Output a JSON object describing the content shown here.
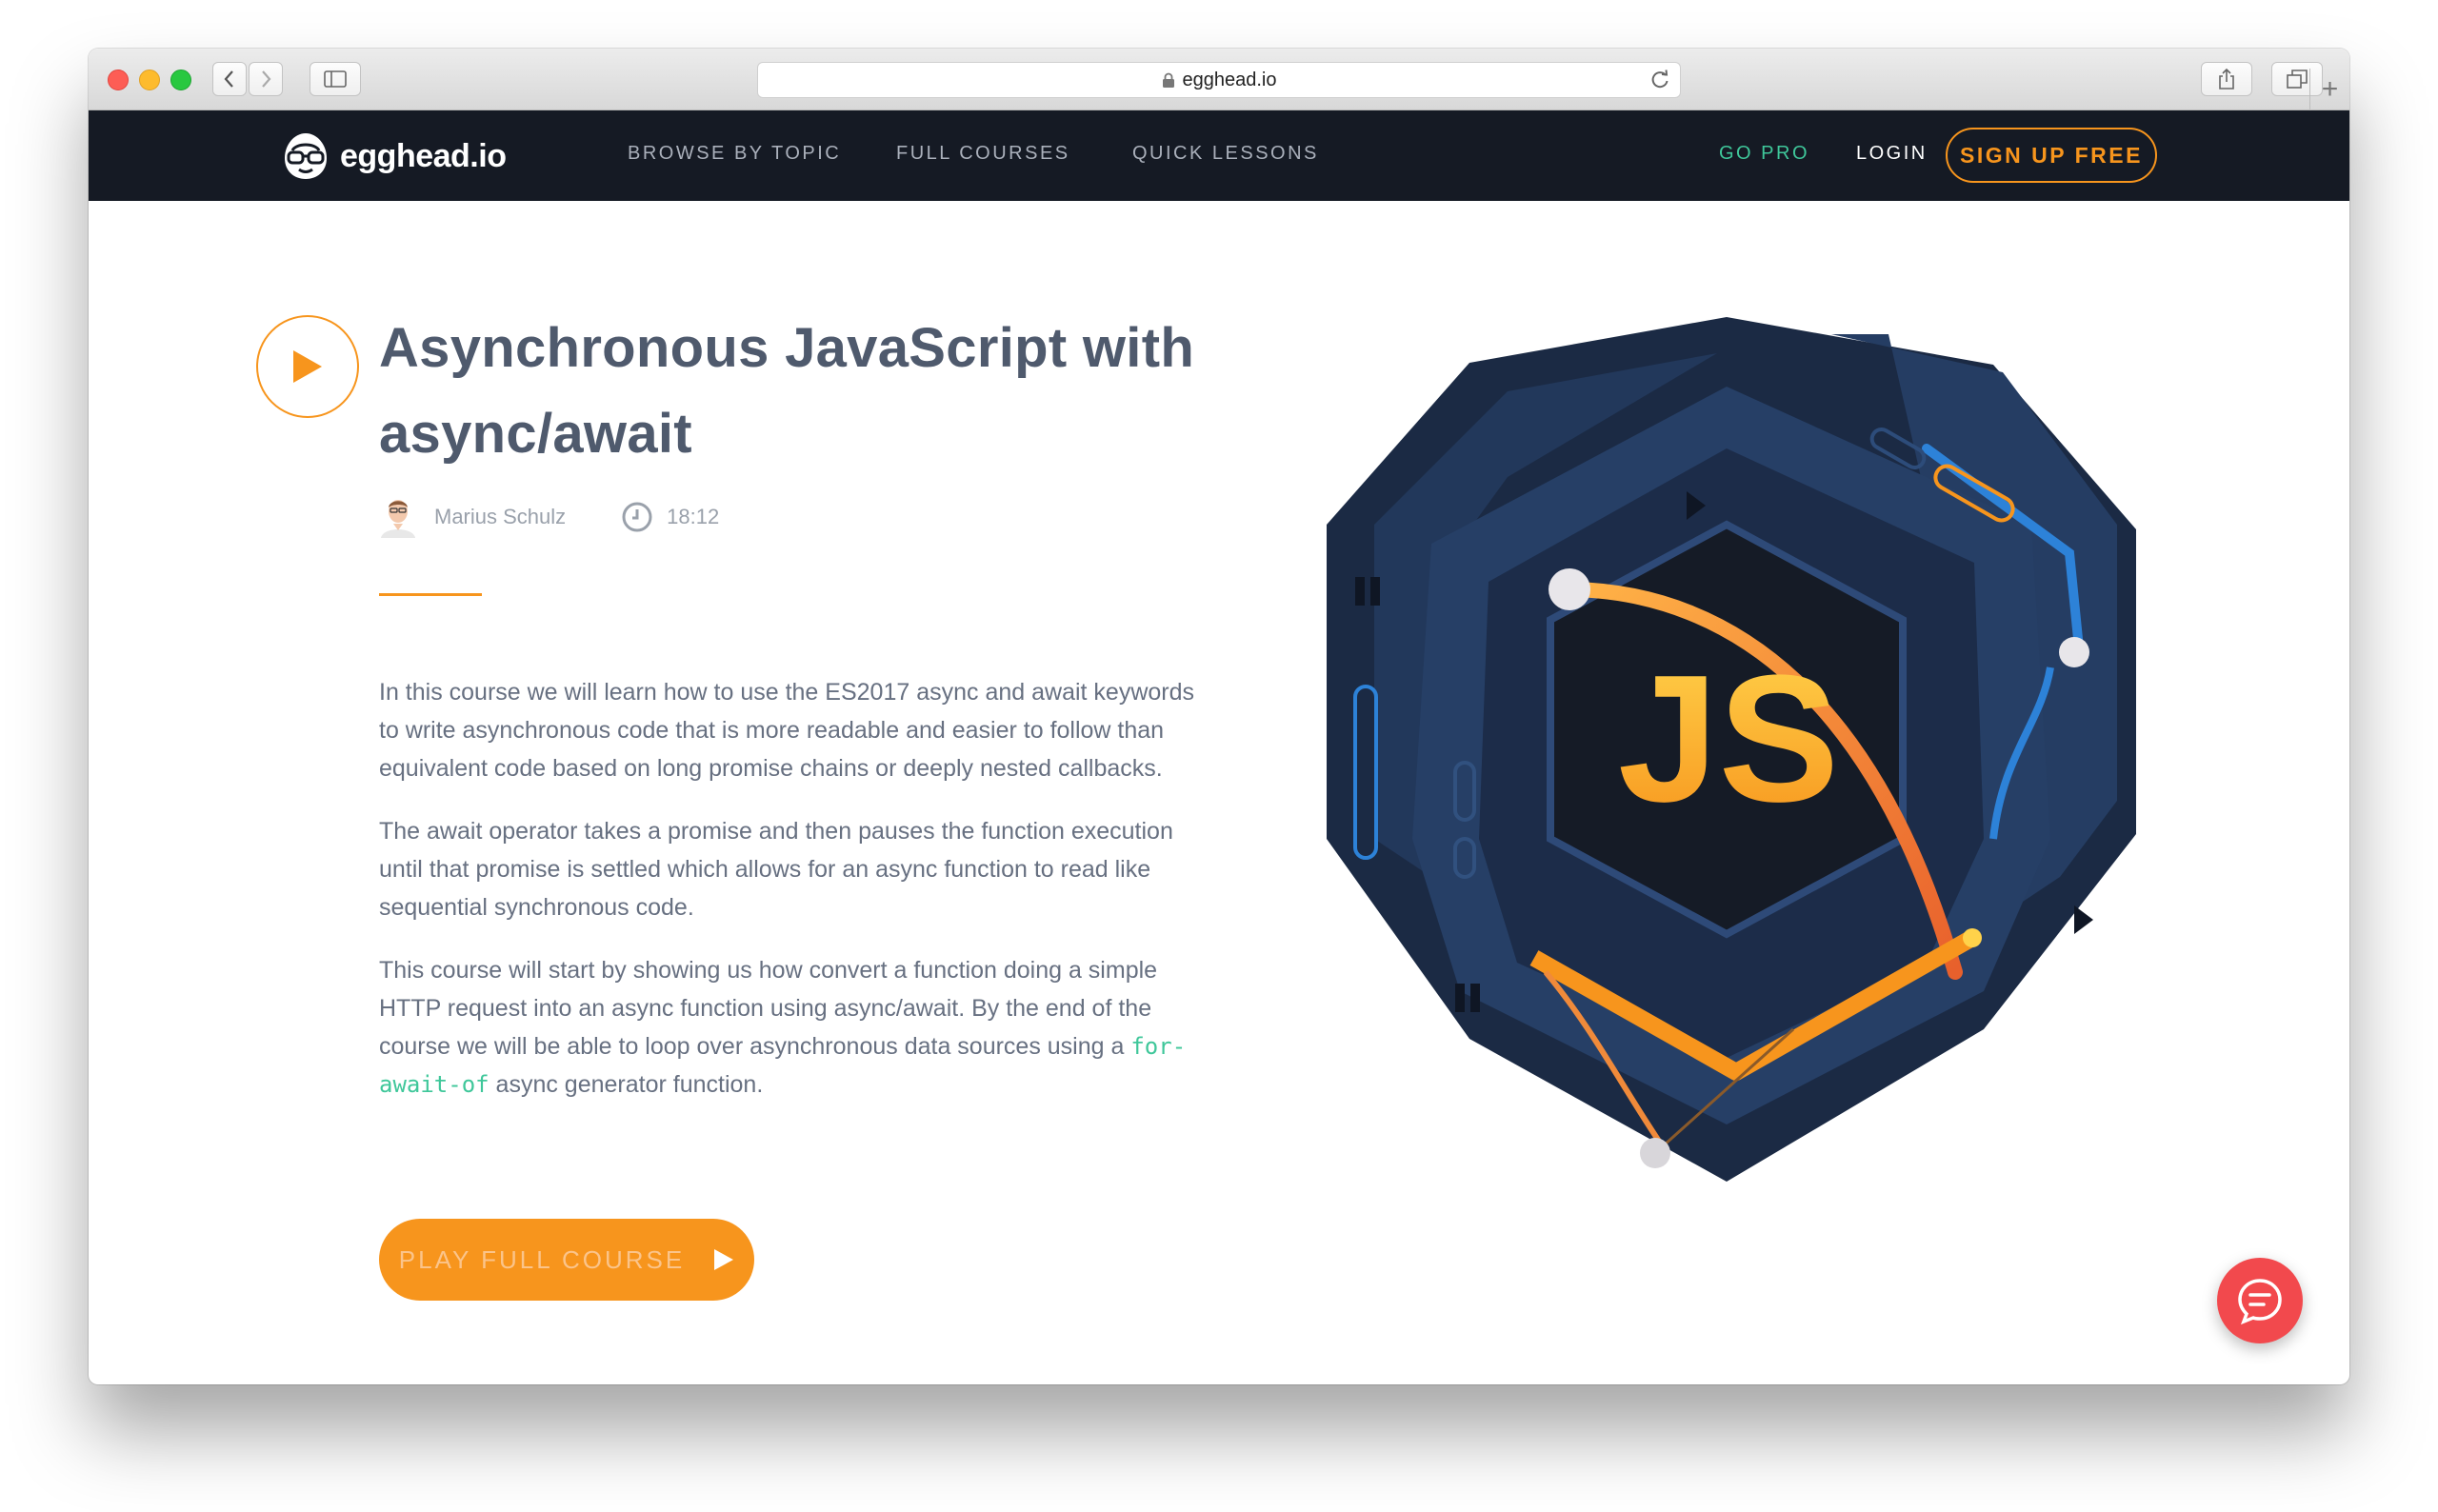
{
  "browser": {
    "url": "egghead.io"
  },
  "nav": {
    "logo": "egghead.io",
    "links": [
      "BROWSE BY TOPIC",
      "FULL COURSES",
      "QUICK LESSONS"
    ],
    "go_pro": "GO PRO",
    "login": "LOGIN",
    "signup": "SIGN UP FREE"
  },
  "course": {
    "title_line1": "Asynchronous JavaScript with",
    "title_line2": "async/await",
    "author": "Marius Schulz",
    "duration": "18:12",
    "paragraph1": "In this course we will learn how to use the ES2017 async and await keywords to write asynchronous code that is more readable and easier to follow than equivalent code based on long promise chains or deeply nested callbacks.",
    "paragraph2": "The await operator takes a promise and then pauses the function execution until that promise is settled which allows for an async function to read like sequential synchronous code.",
    "paragraph3_before": "This course will start by showing us how convert a function doing a simple HTTP request into an async function using async/await. By the end of the course we will be able to loop over asynchronous data sources using a ",
    "paragraph3_code": "for-await-of",
    "paragraph3_after": " async generator function.",
    "cta": "PLAY FULL COURSE",
    "badge_text": "JS"
  },
  "colors": {
    "accent": "#f7951d",
    "nav_bg": "#151a24",
    "go_pro": "#3fc79a",
    "chat": "#f2494d"
  }
}
